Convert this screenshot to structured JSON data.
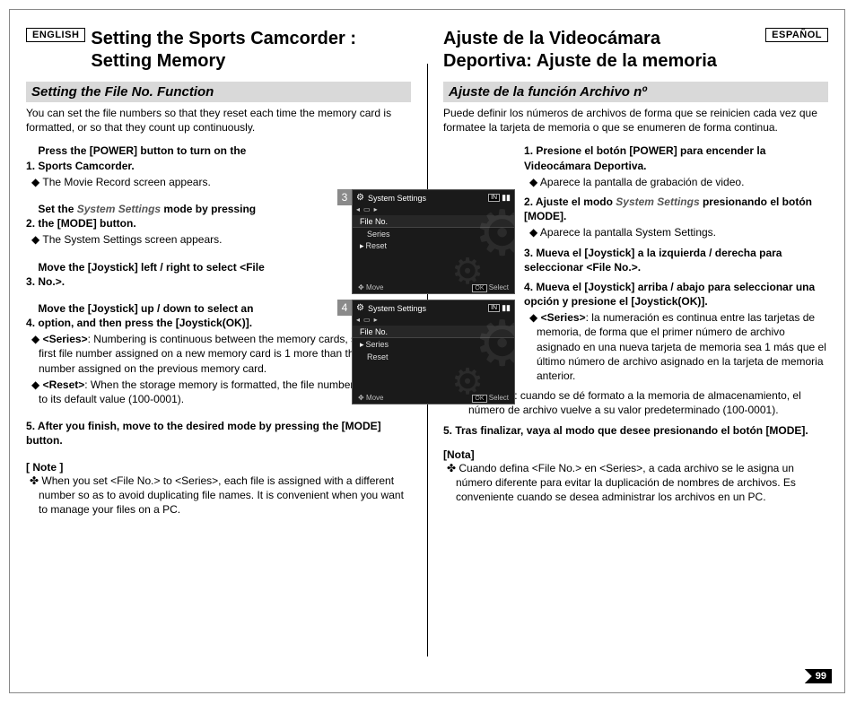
{
  "lang": {
    "en": "ENGLISH",
    "es": "ESPAÑOL"
  },
  "en": {
    "title": "Setting the Sports Camcorder : Setting Memory",
    "subhead": "Setting the File No. Function",
    "intro": "You can set the file numbers so that they reset each time the memory card is formatted, or so that they count up continuously.",
    "s1": "Press the [POWER] button to turn on the Sports Camcorder.",
    "s1a": "The Movie Record screen appears.",
    "s2a": "Set the ",
    "s2mode": "System Settings",
    "s2b": " mode by pressing the [MODE] button.",
    "s2sub": "The System Settings screen appears.",
    "s3": "Move the [Joystick] left / right to select <File No.>.",
    "s4": "Move the [Joystick] up / down to select an option, and then press the [Joystick(OK)].",
    "s4a_b": "<Series>",
    "s4a": ": Numbering is continuous between the memory cards, so that the first file number assigned on a new memory card is 1 more than the last file number assigned on the previous memory card.",
    "s4b_b": "<Reset>",
    "s4b": ": When the storage memory is formatted, the file number goes back to its default value (100-0001).",
    "s5": "After you finish, move to the desired mode by pressing the [MODE] button.",
    "noteHead": "[ Note ]",
    "note": "When you set <File No.> to <Series>, each file is assigned with a different number so as to avoid duplicating file names. It is convenient when you want to manage your files on a PC."
  },
  "es": {
    "title": "Ajuste de la Videocámara Deportiva: Ajuste de la memoria",
    "subhead": "Ajuste de la función Archivo nº",
    "intro": "Puede definir los números de archivos de forma que se reinicien cada vez que formatee la tarjeta de memoria o que se enumeren de forma continua.",
    "s1": "Presione el botón [POWER] para encender la Videocámara Deportiva.",
    "s1a": "Aparece la pantalla de grabación de video.",
    "s2a": "Ajuste el modo ",
    "s2mode": "System Settings",
    "s2b": " presionando el botón [MODE].",
    "s2sub": "Aparece la pantalla System Settings.",
    "s3": "Mueva el [Joystick] a la izquierda / derecha para seleccionar <File No.>.",
    "s4": "Mueva el [Joystick] arriba / abajo para seleccionar una opción y presione el [Joystick(OK)].",
    "s4a_b": "<Series>",
    "s4a": ": la numeración es continua entre las tarjetas de memoria, de forma que el primer número de archivo asignado en una nueva tarjeta de memoria sea 1 más que el último número de archivo asignado en la tarjeta de memoria anterior.",
    "s4b_b": "<Reset>",
    "s4b": ": cuando se dé formato a la memoria de almacenamiento, el número de archivo vuelve a su valor predeterminado (100-0001).",
    "s5": "Tras finalizar, vaya al modo que desee presionando el botón [MODE].",
    "noteHead": "[Nota]",
    "note": "Cuando defina <File No.> en <Series>, a cada archivo se le asigna un número diferente para evitar la duplicación de nombres de archivos. Es conveniente cuando se desea administrar los archivos en un PC."
  },
  "shot": {
    "num3": "3",
    "num4": "4",
    "title": "System Settings",
    "in": "IN",
    "tab": "File No.",
    "series": "Series",
    "reset": "Reset",
    "move": "Move",
    "select": "Select",
    "ok": "OK"
  },
  "pageNum": "99"
}
